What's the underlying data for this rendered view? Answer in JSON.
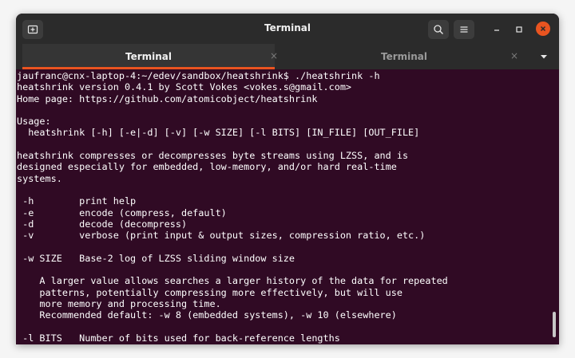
{
  "window": {
    "title": "Terminal"
  },
  "tabs": [
    {
      "label": "Terminal",
      "active": true
    },
    {
      "label": "Terminal",
      "active": false
    }
  ],
  "tab_close_glyph": "×",
  "terminal_lines": [
    "jaufranc@cnx-laptop-4:~/edev/sandbox/heatshrink$ ./heatshrink -h",
    "heatshrink version 0.4.1 by Scott Vokes <vokes.s@gmail.com>",
    "Home page: https://github.com/atomicobject/heatshrink",
    "",
    "Usage:",
    "  heatshrink [-h] [-e|-d] [-v] [-w SIZE] [-l BITS] [IN_FILE] [OUT_FILE]",
    "",
    "heatshrink compresses or decompresses byte streams using LZSS, and is",
    "designed especially for embedded, low-memory, and/or hard real-time",
    "systems.",
    "",
    " -h        print help",
    " -e        encode (compress, default)",
    " -d        decode (decompress)",
    " -v        verbose (print input & output sizes, compression ratio, etc.)",
    "",
    " -w SIZE   Base-2 log of LZSS sliding window size",
    "",
    "    A larger value allows searches a larger history of the data for repeated",
    "    patterns, potentially compressing more effectively, but will use",
    "    more memory and processing time.",
    "    Recommended default: -w 8 (embedded systems), -w 10 (elsewhere)",
    "",
    " -l BITS   Number of bits used for back-reference lengths"
  ],
  "icons": {
    "new_tab": "new-tab-icon",
    "search": "search-icon",
    "menu": "hamburger-menu-icon",
    "minimize": "minimize-icon",
    "maximize": "maximize-icon",
    "close": "close-icon",
    "tab_dropdown": "chevron-down-icon"
  },
  "colors": {
    "terminal_bg": "#300a24",
    "titlebar_bg": "#2b2b2b",
    "accent": "#e95420",
    "text": "#ffffff"
  }
}
